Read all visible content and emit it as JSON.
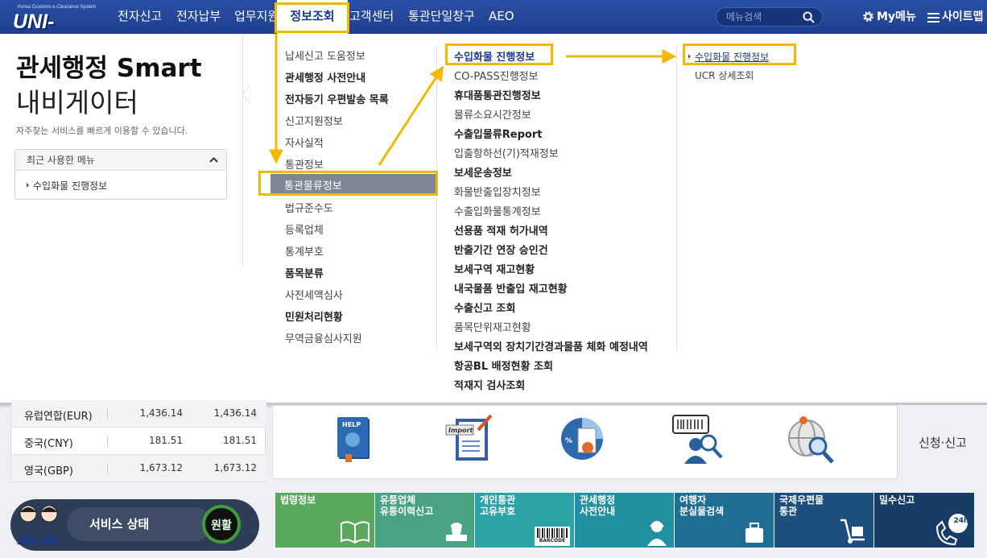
{
  "logo": {
    "system_text": "Korea Customs e-Clearance System",
    "brand": "UNI-PASS"
  },
  "nav": [
    "전자신고",
    "전자납부",
    "업무지원",
    "정보조회",
    "고객센터",
    "통관단일창구",
    "AEO"
  ],
  "search": {
    "placeholder": "메뉴검색"
  },
  "top_right": {
    "my_menu": "My메뉴",
    "sitemap": "사이트맵"
  },
  "navigator": {
    "title_line1": "관세행정 Smart",
    "title_line2": "내비게이터",
    "subtitle": "자주찾는 서비스를 빠르게 이용할 수 있습니다.",
    "recent_header": "최근 사용한 메뉴",
    "recent_items": [
      "수입화물 진행정보"
    ]
  },
  "menu_col1": [
    "납세신고 도움정보",
    "관세행정 사전안내",
    "전자등기 우편발송 목록",
    "신고지원정보",
    "자사실적",
    "통관정보",
    "통관물류정보",
    "법규준수도",
    "등록업체",
    "통계부호",
    "품목분류",
    "사전세액심사",
    "민원처리현황",
    "무역금융심사지원"
  ],
  "menu_col2": [
    "수입화물 진행정보",
    "CO-PASS진행정보",
    "휴대품통관진행정보",
    "물류소요시간정보",
    "수출입물류Report",
    "입출항하선(기)적재정보",
    "보세운송정보",
    "화물반출입장치정보",
    "수출입화물통계정보",
    "선용품 적재 허가내역",
    "반출기간 연장 승인건",
    "보세구역 재고현황",
    "내국물품 반출입 재고현황",
    "수출신고 조회",
    "품목단위재고현황",
    "보세구역외 장치기간경과물품 체화 예정내역",
    "항공BL 배정현황 조회",
    "적재지 검사조회"
  ],
  "menu_col3": [
    "수입화물 진행정보",
    "UCR 상세조회"
  ],
  "exchange_rates": [
    {
      "currency": "유럽연합(EUR)",
      "v1": "1,436.14",
      "v2": "1,436.14"
    },
    {
      "currency": "중국(CNY)",
      "v1": "181.51",
      "v2": "181.51"
    },
    {
      "currency": "영국(GBP)",
      "v1": "1,673.12",
      "v2": "1,673.12"
    }
  ],
  "icons": {
    "help_label": "HELP",
    "import_label": "Import",
    "apply": "신청·신고"
  },
  "service_status": {
    "label": "서비스 상태",
    "value": "원활"
  },
  "tiles": [
    {
      "text": "법령정보",
      "color": "#5aa85c"
    },
    {
      "text": "유통업체\n유통이력신고",
      "color": "#49a383"
    },
    {
      "text": "개인통관\n고유부호",
      "color": "#2aa3a6",
      "sub": "BARCODE"
    },
    {
      "text": "관세행정\n사전안내",
      "color": "#2190a0"
    },
    {
      "text": "여행자\n분실물검색",
      "color": "#1f6f94"
    },
    {
      "text": "국제우편물\n통관",
      "color": "#1c4f7d"
    },
    {
      "text": "밀수신고",
      "color": "#173c66",
      "sub": "24h"
    }
  ],
  "colors": {
    "nav_bg": "#2a4fa5",
    "highlight": "#f5b800",
    "selected_bg": "#7e8796"
  }
}
